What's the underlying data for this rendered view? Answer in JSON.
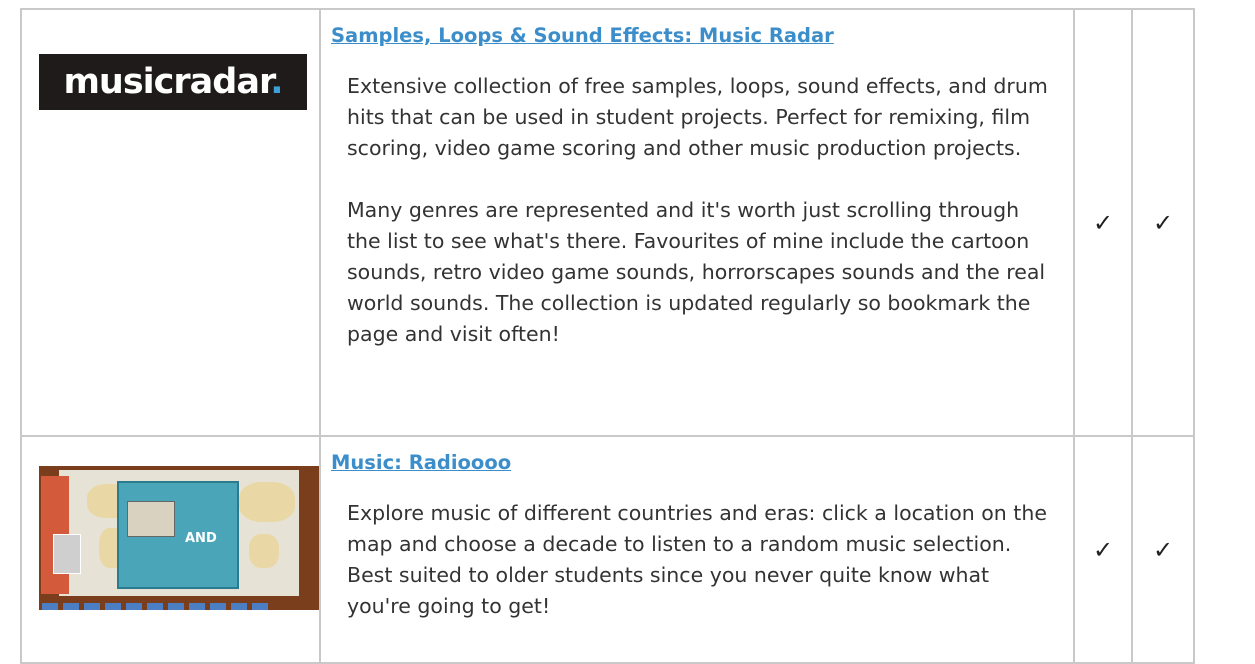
{
  "rows": [
    {
      "logo": {
        "text": "musicradar",
        "dot": "."
      },
      "title": "Samples, Loops & Sound Effects: Music Radar",
      "paragraphs": [
        "Extensive collection of free samples, loops, sound effects, and drum hits that can be used in student projects. Perfect for remixing, film scoring, video game scoring and other music production projects.",
        "Many genres are represented and it's worth just scrolling through the list to see what's there. Favourites of mine include the cartoon sounds, retro video game sounds, horrorscapes sounds and the real world sounds. The collection is updated regularly so bookmark the page and visit often!"
      ],
      "check1": "✓",
      "check2": "✓"
    },
    {
      "thumbnail_icon": "world-map-icon",
      "thumbnail_text": "AND",
      "title": "Music: Radioooo",
      "paragraphs": [
        "Explore music of different countries and eras: click a location on the map and choose a decade to listen to a random music selection. Best suited to older students since you never quite know what you're going to get!"
      ],
      "check1": "✓",
      "check2": "✓"
    }
  ],
  "colors": {
    "link": "#3c8ecb",
    "text": "#333333",
    "border": "#c9c9c9"
  }
}
